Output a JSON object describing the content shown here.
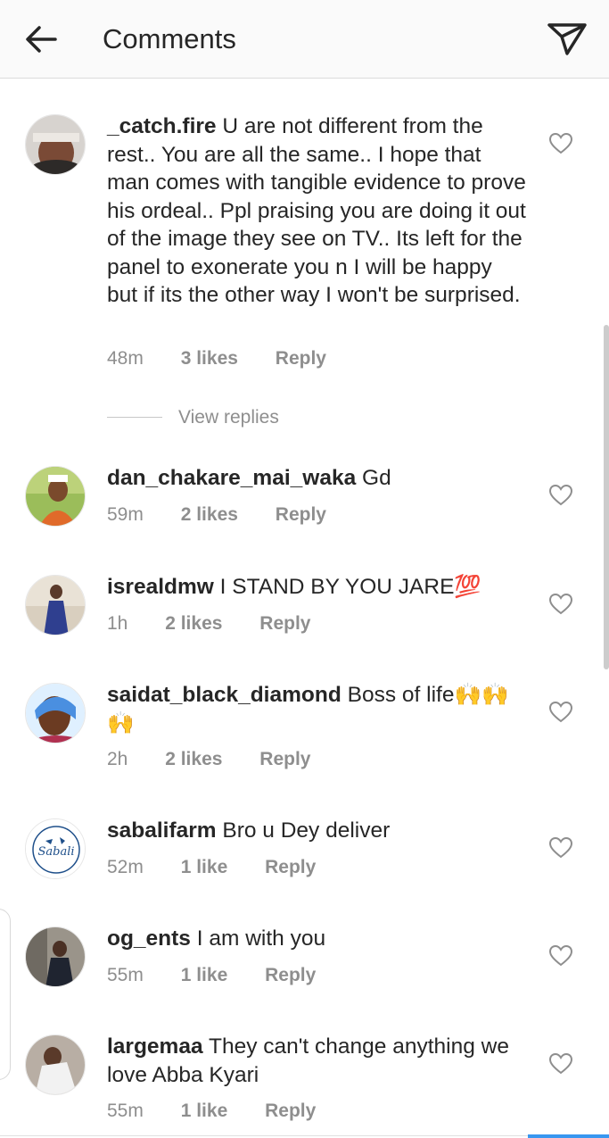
{
  "header": {
    "title": "Comments",
    "back_icon": "arrow-left-icon",
    "share_icon": "paper-plane-icon"
  },
  "comments": [
    {
      "username": "_catch.fire",
      "text": "U are not different from the rest.. You are all the same.. I hope that man comes with tangible evidence to prove his ordeal.. Ppl praising you are doing it out of the image they see on TV.. Its left for the panel to exonerate you n I will be happy but if its the other way I won't be surprised.",
      "time": "48m",
      "likes": "3 likes",
      "reply": "Reply"
    },
    {
      "username": "dan_chakare_mai_waka",
      "text": "Gd",
      "time": "59m",
      "likes": "2 likes",
      "reply": "Reply"
    },
    {
      "username": "isrealdmw",
      "text": "I STAND BY YOU JARE💯",
      "time": "1h",
      "likes": "2 likes",
      "reply": "Reply"
    },
    {
      "username": "saidat_black_diamond",
      "text": "Boss of life🙌🙌🙌",
      "time": "2h",
      "likes": "2 likes",
      "reply": "Reply"
    },
    {
      "username": "sabalifarm",
      "text": "Bro u Dey deliver",
      "time": "52m",
      "likes": "1 like",
      "reply": "Reply"
    },
    {
      "username": "og_ents",
      "text": "I am with you",
      "time": "55m",
      "likes": "1 like",
      "reply": "Reply"
    },
    {
      "username": "largemaa",
      "text": "They can't change anything we love Abba Kyari",
      "time": "55m",
      "likes": "1 like",
      "reply": "Reply"
    }
  ],
  "view_replies": "View replies",
  "avatar_logo_text": "Sabali",
  "colors": {
    "meta": "#8e8e8e",
    "text": "#262626",
    "accent": "#3897f0"
  }
}
